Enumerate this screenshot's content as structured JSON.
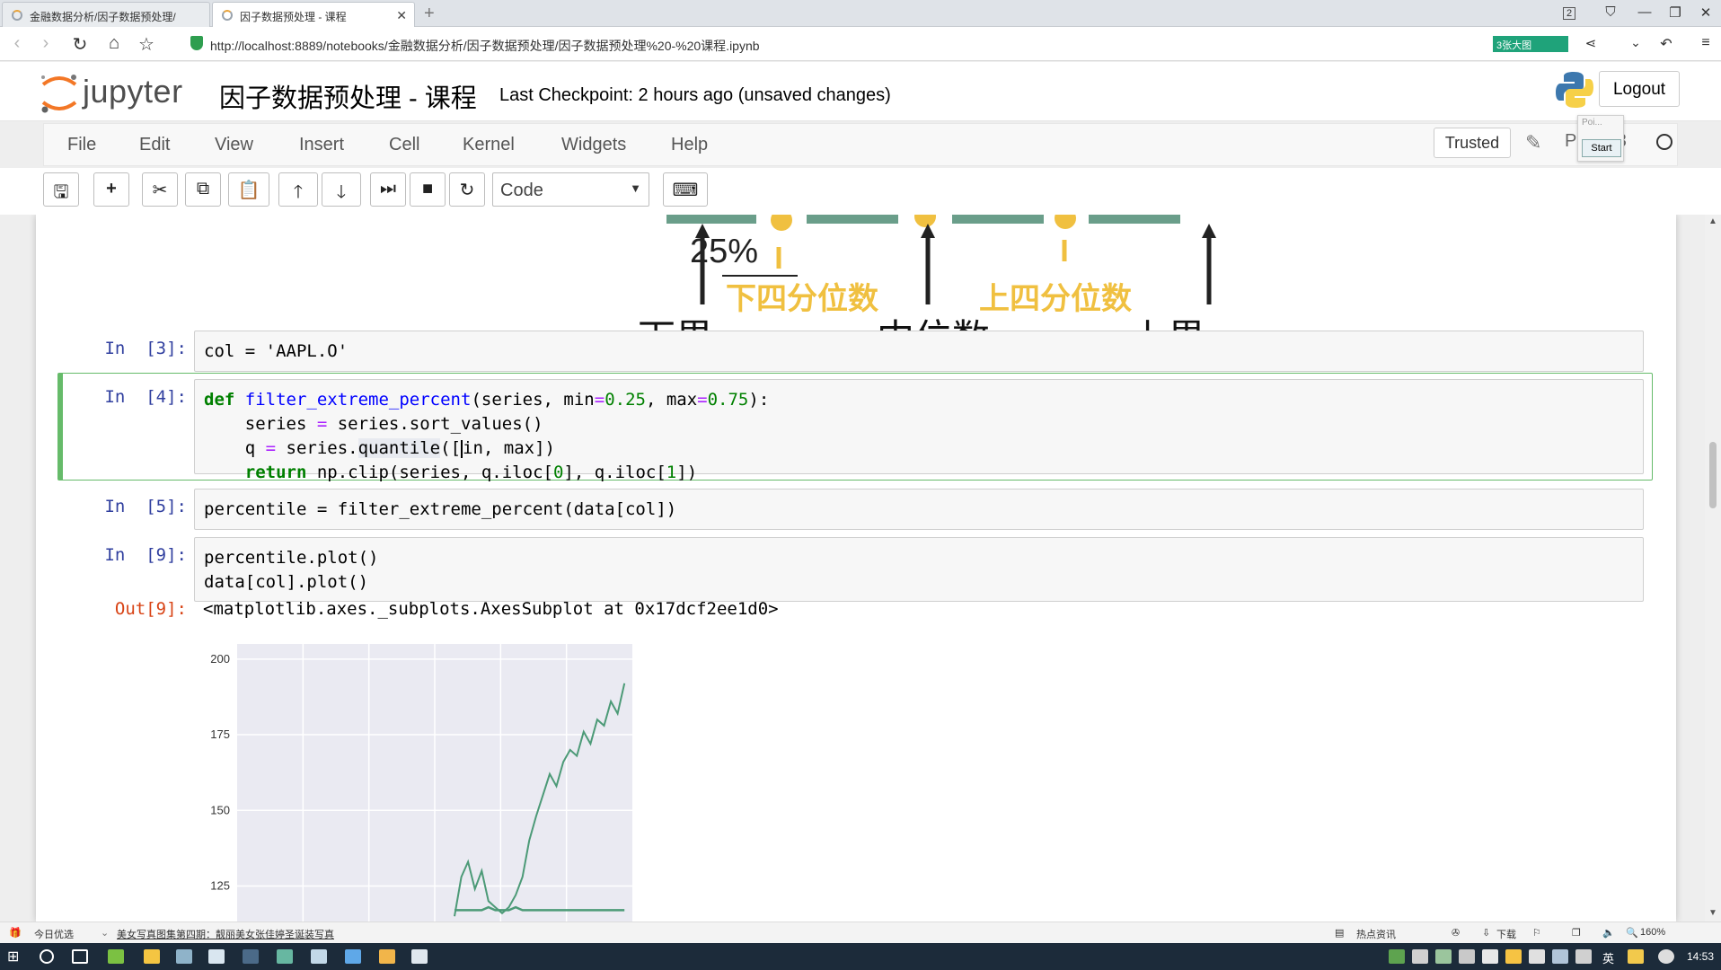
{
  "browser": {
    "tabs": [
      {
        "label": "金融数据分析/因子数据预处理/",
        "active": false
      },
      {
        "label": "因子数据预处理 - 课程",
        "active": true
      }
    ],
    "url": "http://localhost:8889/notebooks/金融数据分析/因子数据预处理/因子数据预处理%20-%20课程.ipynb",
    "addr_badge": "3张大图",
    "window_page_num": "2"
  },
  "header": {
    "logo_text": "jupyter",
    "notebook_title": "因子数据预处理 - 课程",
    "checkpoint": "Last Checkpoint: 2 hours ago (unsaved changes)",
    "logout": "Logout"
  },
  "menubar": {
    "items": [
      "File",
      "Edit",
      "View",
      "Insert",
      "Cell",
      "Kernel",
      "Widgets",
      "Help"
    ],
    "trusted": "Trusted",
    "kernel_name": "P",
    "kernel_name_suffix": "3",
    "popup_label": "Poi...",
    "popup_button": "Start"
  },
  "toolbar": {
    "cell_type": "Code",
    "cell_type_options": [
      "Code"
    ]
  },
  "figure_labels": {
    "percent": "25%",
    "lower_quartile": "下四分位数",
    "upper_quartile": "上四分位数",
    "lower_bound": "下界",
    "median": "中位数",
    "upper_bound": "上界"
  },
  "cells": {
    "c3": {
      "prompt": "In  [3]:",
      "code": "col = 'AAPL.O'"
    },
    "c4": {
      "prompt": "In  [4]:"
    },
    "c5": {
      "prompt": "In  [5]:",
      "code": "percentile = filter_extreme_percent(data[col])"
    },
    "c9": {
      "prompt": "In  [9]:",
      "line1": "percentile.plot()",
      "line2": "data[col].plot()",
      "out_prompt": "Out[9]:",
      "out_text": "<matplotlib.axes._subplots.AxesSubplot at 0x17dcf2ee1d0>"
    }
  },
  "chart_data": {
    "type": "line",
    "title": "",
    "xlabel": "",
    "ylabel": "",
    "y_ticks": [
      "200",
      "175",
      "150",
      "125"
    ],
    "ylim": [
      110,
      205
    ],
    "series": [
      {
        "values": [
          117,
          117,
          117,
          117,
          117,
          118,
          117,
          117,
          117,
          118,
          117,
          117,
          117,
          117,
          117,
          117,
          117,
          117,
          117,
          117,
          117,
          117,
          117,
          117,
          117,
          117
        ]
      },
      {
        "values": [
          115,
          128,
          133,
          124,
          130,
          120,
          118,
          116,
          118,
          122,
          128,
          140,
          148,
          155,
          162,
          158,
          166,
          170,
          168,
          176,
          172,
          180,
          178,
          186,
          182,
          192
        ]
      }
    ],
    "grid": true,
    "background": "#eaeaf2",
    "line_color": "#4c9a77"
  },
  "statusbar": {
    "left_label": "今日优选",
    "news": "美女写真图集第四期：靓丽美女张佳婷圣诞装写真",
    "hot": "热点资讯",
    "download": "下载",
    "zoom": "160%"
  },
  "taskbar": {
    "time": "14:53",
    "ime": "英"
  },
  "colors": {
    "prompt_in": "#303f9f",
    "prompt_out": "#d84315",
    "selected_border": "#66bb6a",
    "quartile_label": "#f0c040",
    "box_fill": "#6a9e8a"
  }
}
